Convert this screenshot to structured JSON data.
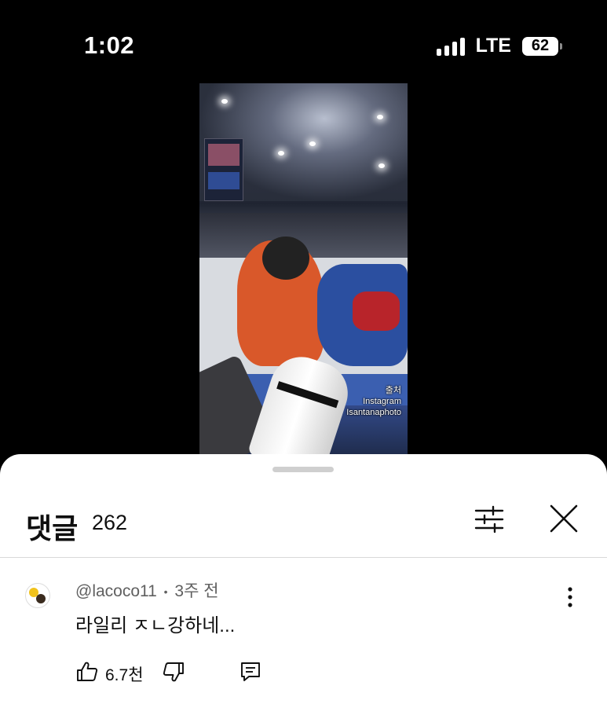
{
  "status_bar": {
    "time": "1:02",
    "network": "LTE",
    "battery": "62"
  },
  "video": {
    "credit_line1": "출처",
    "credit_line2": "Instagram",
    "credit_line3": "Isantanaphoto"
  },
  "comments_panel": {
    "title": "댓글",
    "count": "262",
    "filter_icon": "sliders-icon",
    "close_icon": "close-icon"
  },
  "comments": [
    {
      "author": "@lacoco11",
      "separator": "•",
      "time": "3주 전",
      "text": "라일리 ㅈㄴ강하네...",
      "likes": "6.7천",
      "like_icon": "thumbs-up-icon",
      "dislike_icon": "thumbs-down-icon",
      "reply_icon": "reply-icon",
      "more_icon": "more-vertical-icon"
    }
  ]
}
